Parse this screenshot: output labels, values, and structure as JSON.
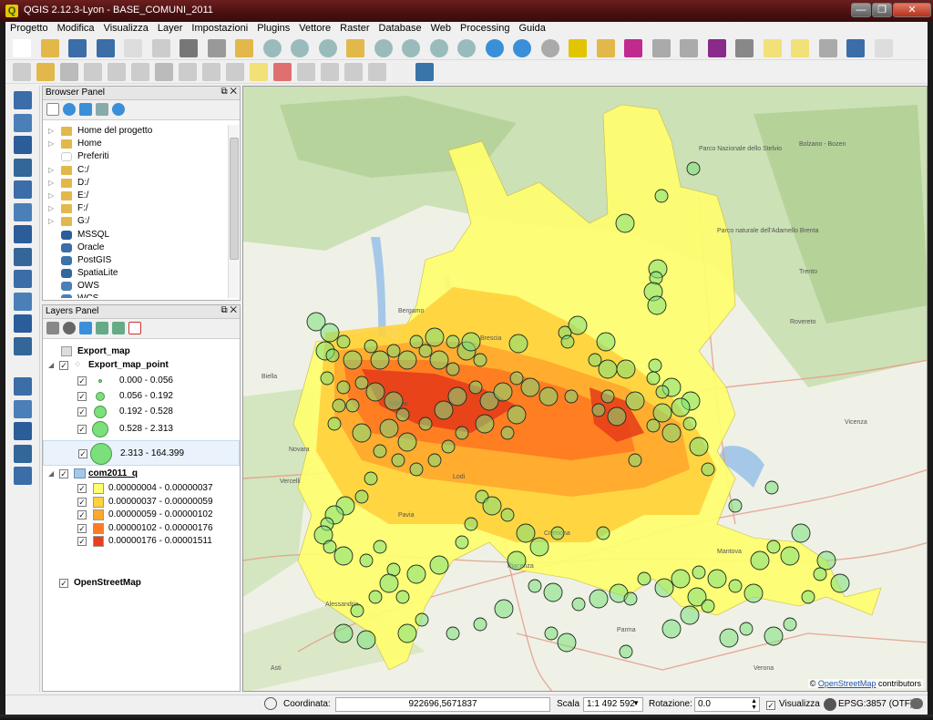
{
  "window": {
    "title": "QGIS 2.12.3-Lyon - BASE_COMUNI_2011",
    "app_icon_glyph": "Q",
    "minimize": "—",
    "maximize": "❐",
    "close": "✕"
  },
  "menu": [
    "Progetto",
    "Modifica",
    "Visualizza",
    "Layer",
    "Impostazioni",
    "Plugins",
    "Vettore",
    "Raster",
    "Database",
    "Web",
    "Processing",
    "Guida"
  ],
  "browser_panel": {
    "title": "Browser Panel",
    "items": [
      {
        "label": "Home del progetto",
        "icon": "folder-icon"
      },
      {
        "label": "Home",
        "icon": "folder-icon"
      },
      {
        "label": "Preferiti",
        "icon": "star-icon"
      },
      {
        "label": "C:/",
        "icon": "folder-icon"
      },
      {
        "label": "D:/",
        "icon": "folder-icon"
      },
      {
        "label": "E:/",
        "icon": "folder-icon"
      },
      {
        "label": "F:/",
        "icon": "folder-icon"
      },
      {
        "label": "G:/",
        "icon": "folder-icon"
      },
      {
        "label": "MSSQL",
        "icon": "mssql-icon"
      },
      {
        "label": "Oracle",
        "icon": "oracle-icon"
      },
      {
        "label": "PostGIS",
        "icon": "postgis-icon"
      },
      {
        "label": "SpatiaLite",
        "icon": "spatialite-icon"
      },
      {
        "label": "OWS",
        "icon": "ows-icon"
      },
      {
        "label": "WCS",
        "icon": "wcs-icon"
      }
    ]
  },
  "layers_panel": {
    "title": "Layers Panel",
    "group": "Export_map",
    "point_layer": {
      "name": "Export_map_point",
      "classes": [
        "0.000 - 0.056",
        "0.056 - 0.192",
        "0.192 - 0.528",
        "0.528 - 2.313",
        "2.313 - 164.399"
      ],
      "color": "#7be07b"
    },
    "poly_layer": {
      "name": "com2011_q",
      "classes": [
        "0.00000004 - 0.00000037",
        "0.00000037 - 0.00000059",
        "0.00000059 - 0.00000102",
        "0.00000102 - 0.00000176",
        "0.00000176 - 0.00001511"
      ],
      "colors": [
        "#ffff6e",
        "#ffd23c",
        "#ffa82e",
        "#ff7a22",
        "#e8401a"
      ]
    },
    "basemap": "OpenStreetMap"
  },
  "map": {
    "attribution_prefix": "©",
    "attribution_link": "OpenStreetMap",
    "attribution_suffix": "contributors",
    "place_labels": [
      "Bolzano - Bozen",
      "Parco naturale dell'Adamello Brenta",
      "Parco Nazionale dello Stelvio",
      "Trento",
      "Rovereto",
      "Verona",
      "Vicenza",
      "Novara",
      "Vercelli",
      "Alessandria",
      "Piacenza",
      "Parma",
      "Cremona",
      "Mantova",
      "Brescia",
      "Bergamo",
      "Milano",
      "Pavia",
      "Lodi",
      "Biella",
      "Asti"
    ]
  },
  "status": {
    "coord_label": "Coordinata:",
    "coord_value": "922696,5671837",
    "scale_label": "Scala",
    "scale_value": "1:1 492 592",
    "rotation_label": "Rotazione:",
    "rotation_value": "0.0",
    "render_label": "Visualizza",
    "crs": "EPSG:3857 (OTF)"
  }
}
